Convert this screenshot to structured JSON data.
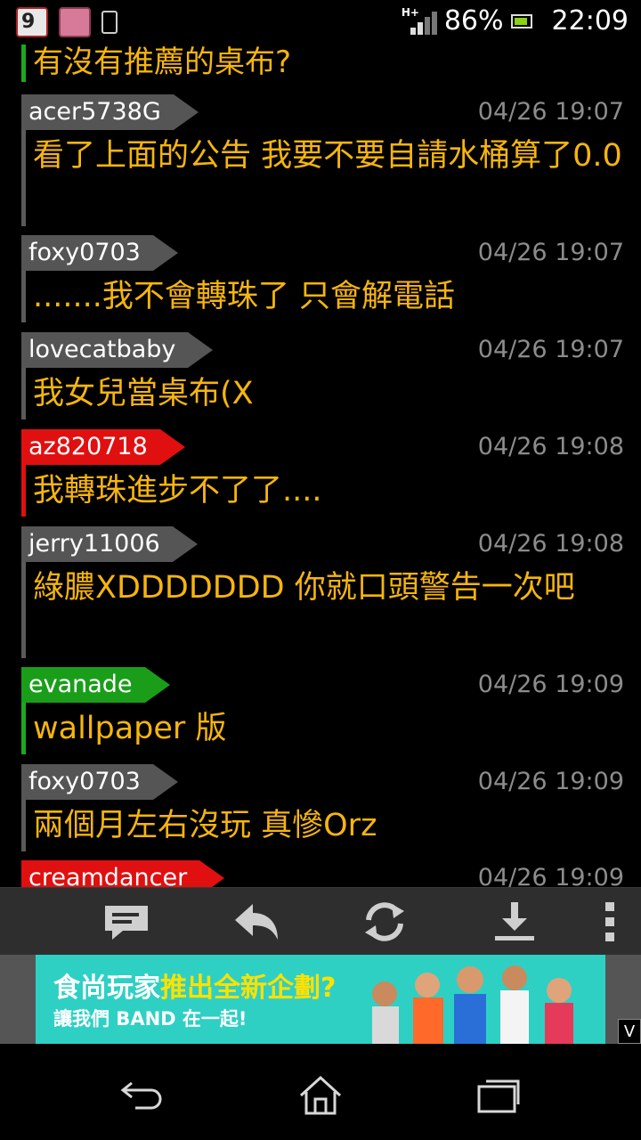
{
  "status_bar": {
    "calendar_day": "9",
    "network": "H+",
    "battery_percent": "86%",
    "time": "22:09"
  },
  "topic": "有沒有推薦的桌布?",
  "messages": [
    {
      "user": "acer5738G",
      "time": "04/26 19:07",
      "text": "看了上面的公告 我要不要自請水桶算了0.0",
      "tag_color": "gray"
    },
    {
      "user": "foxy0703",
      "time": "04/26 19:07",
      "text": ".......我不會轉珠了 只會解電話",
      "tag_color": "gray"
    },
    {
      "user": "lovecatbaby",
      "time": "04/26 19:07",
      "text": "我女兒當桌布(X",
      "tag_color": "gray"
    },
    {
      "user": "az820718",
      "time": "04/26 19:08",
      "text": "我轉珠進步不了了....",
      "tag_color": "red"
    },
    {
      "user": "jerry11006",
      "time": "04/26 19:08",
      "text": "綠膿XDDDDDDD 你就口頭警告一次吧",
      "tag_color": "gray"
    },
    {
      "user": "evanade",
      "time": "04/26 19:09",
      "text": "wallpaper 版",
      "tag_color": "green"
    },
    {
      "user": "foxy0703",
      "time": "04/26 19:09",
      "text": "兩個月左右沒玩 真慘Orz",
      "tag_color": "gray"
    },
    {
      "user": "creamdancer",
      "time": "04/26 19:09",
      "text": "",
      "tag_color": "red"
    }
  ],
  "toolbar": {
    "buttons": [
      "comment-icon",
      "reply-icon",
      "refresh-icon",
      "download-icon",
      "overflow-menu-icon"
    ]
  },
  "ad": {
    "line1_part1": "食尚玩家",
    "line1_part2": "推出全新企劃?",
    "line2": "讓我們 BAND 在一起!",
    "close_label": "V"
  },
  "colors": {
    "message_text": "#f6b50e",
    "timestamp": "#8c8c8c",
    "tag_gray": "#555555",
    "tag_red": "#e01010",
    "tag_green": "#1a9e1a",
    "ad_background": "#2ed0c4"
  }
}
